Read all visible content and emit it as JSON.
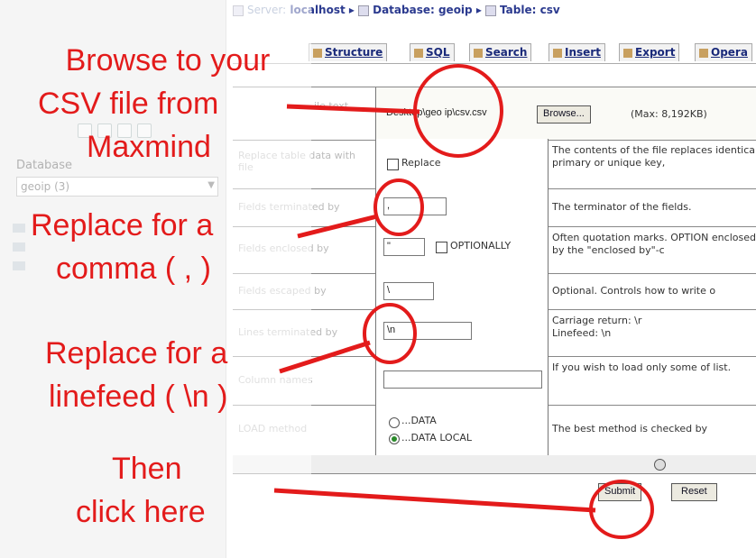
{
  "sidebar": {
    "label": "Database",
    "db_value": "geoip (3)"
  },
  "breadcrumb": {
    "server": "Server:",
    "server_name": "localhost",
    "database": "Database: geoip",
    "table": "Table: csv"
  },
  "tabs": [
    {
      "label": "Structure"
    },
    {
      "label": "SQL"
    },
    {
      "label": "Search"
    },
    {
      "label": "Insert"
    },
    {
      "label": "Export"
    },
    {
      "label": "Opera"
    }
  ],
  "form": {
    "file_label": "ile text",
    "file_value": "Desktop\\geo ip\\csv.csv",
    "browse_label": "Browse...",
    "max_label": "(Max: 8,192KB)",
    "replace_label": "Replace table data with file",
    "replace_check": "Replace",
    "replace_desc": "The contents of the file replaces identical primary or unique key,",
    "fields_term_label": "Fields terminated by",
    "fields_term_value": ",",
    "fields_term_desc": "The terminator of the fields.",
    "fields_encl_label": "Fields enclosed by",
    "fields_encl_value": "\"",
    "optionally_label": "OPTIONALLY",
    "fields_encl_desc": "Often quotation marks. OPTION enclosed by the \"enclosed by\"-c",
    "fields_esc_label": "Fields escaped by",
    "fields_esc_value": "\\",
    "fields_esc_desc": "Optional. Controls how to write o",
    "lines_term_label": "Lines terminated by",
    "lines_term_value": "\\n",
    "lines_term_desc": "Carriage return: \\r\nLinefeed: \\n",
    "columns_label": "Column names",
    "columns_desc": "If you wish to load only some of list.",
    "load_label": "LOAD method",
    "load_opt1": "...DATA",
    "load_opt2": "...DATA LOCAL",
    "load_desc": "The best method is checked by",
    "submit_label": "Submit",
    "reset_label": "Reset"
  },
  "annotations": {
    "browse": "Browse to your\nCSV file from\nMaxmind",
    "comma": "Replace for a\ncomma ( , )",
    "linefeed": "Replace for a\nlinefeed ( \\n )",
    "submit": "Then\nclick here"
  },
  "colors": {
    "annotation": "#e31b1b",
    "tab_text": "#1a2a7a"
  }
}
